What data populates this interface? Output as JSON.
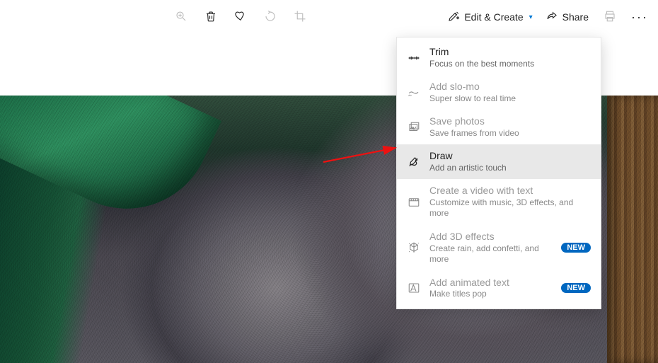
{
  "toolbar": {
    "edit_create_label": "Edit & Create",
    "share_label": "Share"
  },
  "menu": {
    "items": [
      {
        "title": "Trim",
        "sub": "Focus on the best moments",
        "icon": "trim",
        "enabled": true,
        "highlight": false,
        "badge": null
      },
      {
        "title": "Add slo-mo",
        "sub": "Super slow to real time",
        "icon": "slomo",
        "enabled": false,
        "highlight": false,
        "badge": null
      },
      {
        "title": "Save photos",
        "sub": "Save frames from video",
        "icon": "savephotos",
        "enabled": false,
        "highlight": false,
        "badge": null
      },
      {
        "title": "Draw",
        "sub": "Add an artistic touch",
        "icon": "draw",
        "enabled": true,
        "highlight": true,
        "badge": null
      },
      {
        "title": "Create a video with text",
        "sub": "Customize with music, 3D effects, and more",
        "icon": "videotext",
        "enabled": false,
        "highlight": false,
        "badge": null
      },
      {
        "title": "Add 3D effects",
        "sub": "Create rain, add confetti, and more",
        "icon": "3deffects",
        "enabled": false,
        "highlight": false,
        "badge": "NEW"
      },
      {
        "title": "Add animated text",
        "sub": "Make titles pop",
        "icon": "animtext",
        "enabled": false,
        "highlight": false,
        "badge": "NEW"
      }
    ]
  }
}
